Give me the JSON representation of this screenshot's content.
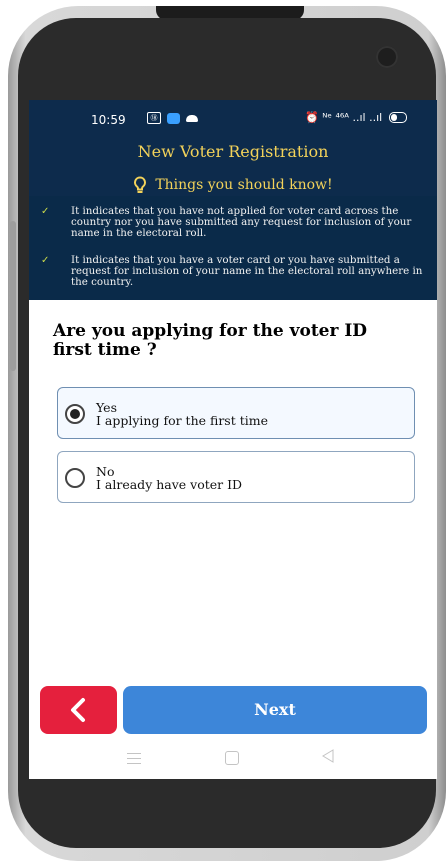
{
  "status_bar": {
    "time": "10:59",
    "sim_badge": "⑱",
    "right_icons": "⏰ ᴺᵉ ⁴⁶ᴬ ..ıl ..ıl"
  },
  "header": {
    "title": "New Voter Registration",
    "subtitle": "Things you should know!"
  },
  "info_items": [
    {
      "text": "It indicates that you have not applied for voter card across the country nor you have submitted any request for inclusion of your name in the electoral roll."
    },
    {
      "text": "It indicates that you have a voter card or you have submitted a request for inclusion of your name in the electoral roll anywhere in the country."
    }
  ],
  "question": "Are you applying for the voter ID first time ?",
  "options": [
    {
      "title": "Yes",
      "description": "I applying for the first time",
      "selected": true
    },
    {
      "title": "No",
      "description": "I already have voter ID",
      "selected": false
    }
  ],
  "buttons": {
    "next": "Next"
  },
  "colors": {
    "header_bg": "#0d2b4c",
    "header_text": "#f2d25a",
    "back_button": "#e5203d",
    "next_button": "#3d86d9"
  }
}
